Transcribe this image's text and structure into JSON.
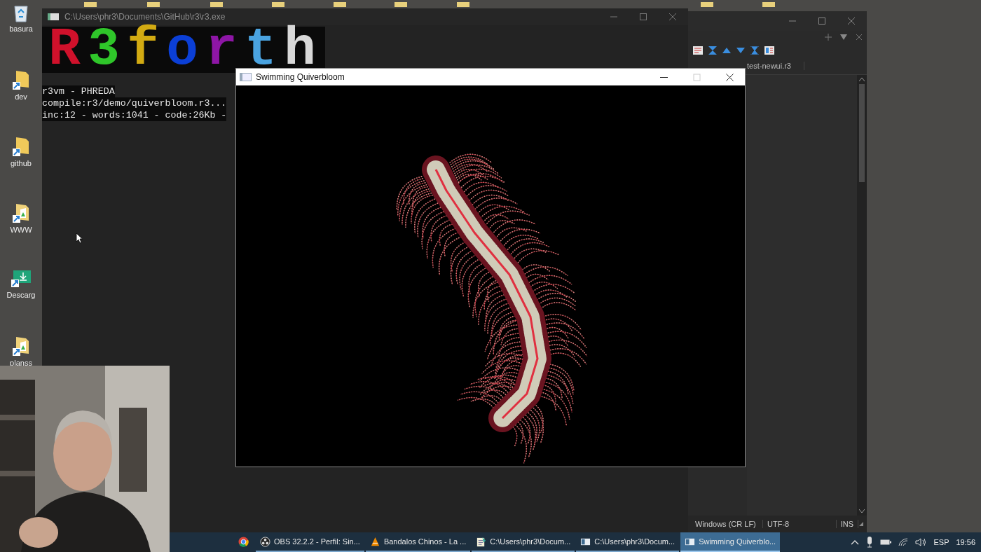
{
  "desktop_icons": [
    {
      "label": "basura",
      "kind": "recycle"
    },
    {
      "label": "dev",
      "kind": "folder"
    },
    {
      "label": "github",
      "kind": "folder"
    },
    {
      "label": "WWW",
      "kind": "docfolder"
    },
    {
      "label": "Descarg",
      "kind": "download"
    },
    {
      "label": "planss",
      "kind": "docfolder"
    }
  ],
  "console_window": {
    "title": "C:\\Users\\phr3\\Documents\\GitHub\\r3\\r3.exe",
    "logo": [
      {
        "char": "R",
        "color": "#d0112b"
      },
      {
        "char": "3",
        "color": "#2fc62a"
      },
      {
        "char": "f",
        "color": "#d3ab12"
      },
      {
        "char": "o",
        "color": "#0b3fd6"
      },
      {
        "char": "r",
        "color": "#8e16a6"
      },
      {
        "char": "t",
        "color": "#4aa3e0"
      },
      {
        "char": "h",
        "color": "#d8d8d8"
      }
    ],
    "lines": [
      "r3vm - PHREDA",
      "compile:r3/demo/quiverbloom.r3...",
      "inc:12 - words:1041 - code:26Kb -"
    ]
  },
  "editor_window": {
    "tabs": [
      {
        "label": "test-newui.r3"
      }
    ],
    "status_bar": [
      "Windows (CR LF)",
      "UTF-8",
      "INS"
    ]
  },
  "demo_window": {
    "title": "Swimming Quiverbloom"
  },
  "taskbar": {
    "items": [
      {
        "kind": "chrome",
        "selected": false
      },
      {
        "kind": "obs",
        "label": "OBS 32.2.2 - Perfil: Sin...",
        "selected": false
      },
      {
        "kind": "vlc",
        "label": "Bandalos Chinos - La ...",
        "selected": false
      },
      {
        "kind": "notepad",
        "label": "C:\\Users\\phr3\\Docum...",
        "selected": false
      },
      {
        "kind": "console",
        "label": "C:\\Users\\phr3\\Docum...",
        "selected": false
      },
      {
        "kind": "console",
        "label": "Swimming Quiverblo...",
        "selected": true
      }
    ],
    "language": "ESP",
    "time": "19:56"
  }
}
